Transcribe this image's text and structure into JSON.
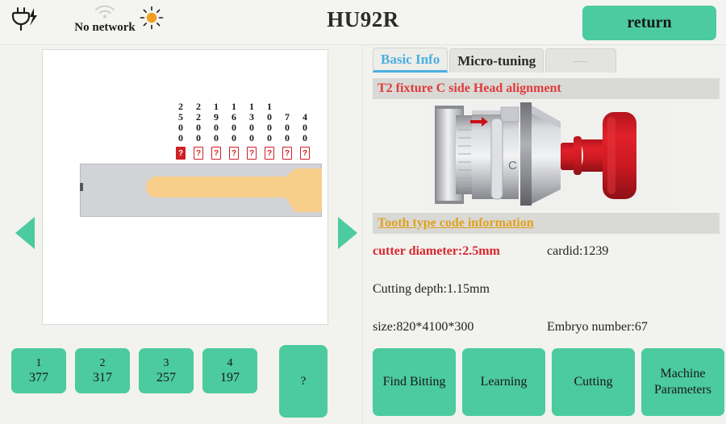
{
  "statusbar": {
    "power_icon": "power-plug-charging-icon",
    "wifi_icon": "wifi-icon",
    "wifi_label": "No network",
    "brightness_icon": "sun-brightness-icon",
    "title": "HU92R",
    "return_label": "return"
  },
  "left": {
    "nav_prev_icon": "chevron-left-icon",
    "nav_next_icon": "chevron-right-icon",
    "key_diagram": {
      "columns": [
        {
          "digits": [
            "2",
            "5",
            "0",
            "0"
          ],
          "mark": "?",
          "active": true
        },
        {
          "digits": [
            "2",
            "2",
            "0",
            "0"
          ],
          "mark": "?",
          "active": false
        },
        {
          "digits": [
            "1",
            "9",
            "0",
            "0"
          ],
          "mark": "?",
          "active": false
        },
        {
          "digits": [
            "1",
            "6",
            "0",
            "0"
          ],
          "mark": "?",
          "active": false
        },
        {
          "digits": [
            "1",
            "3",
            "0",
            "0"
          ],
          "mark": "?",
          "active": false
        },
        {
          "digits": [
            "1",
            "0",
            "0",
            "0"
          ],
          "mark": "?",
          "active": false
        },
        {
          "digits": [
            "",
            "7",
            "0",
            "0"
          ],
          "mark": "?",
          "active": false
        },
        {
          "digits": [
            "",
            "4",
            "0",
            "0"
          ],
          "mark": "?",
          "active": false
        }
      ]
    },
    "cut_buttons": [
      {
        "index": "1",
        "value": "377"
      },
      {
        "index": "2",
        "value": "317"
      },
      {
        "index": "3",
        "value": "257"
      },
      {
        "index": "4",
        "value": "197"
      }
    ],
    "help_label": "?"
  },
  "right": {
    "tabs": [
      {
        "label": "Basic Info",
        "active": true
      },
      {
        "label": "Micro-tuning",
        "active": false
      },
      {
        "label": "------",
        "active": false
      }
    ],
    "fixture_heading": "T2 fixture C side Head alignment",
    "fixture_image_icon": "fixture-clamp-diagram",
    "tooth_heading": "Tooth type code information",
    "details": [
      {
        "left": "cutter diameter:2.5mm",
        "right": "cardid:1239"
      },
      {
        "left": "Cutting depth:1.15mm",
        "right": ""
      },
      {
        "left": "size:820*4100*300",
        "right": "Embryo number:67"
      }
    ],
    "actions": [
      {
        "label": "Find Bitting"
      },
      {
        "label": "Learning"
      },
      {
        "label": "Cutting"
      },
      {
        "label": "Machine Parameters"
      }
    ]
  },
  "colors": {
    "accent_green": "#4ccaa0",
    "tab_blue": "#49b0e0",
    "alert_red": "#e03a3a",
    "gold": "#e0a11e",
    "page_bg": "#f2f2ef"
  }
}
